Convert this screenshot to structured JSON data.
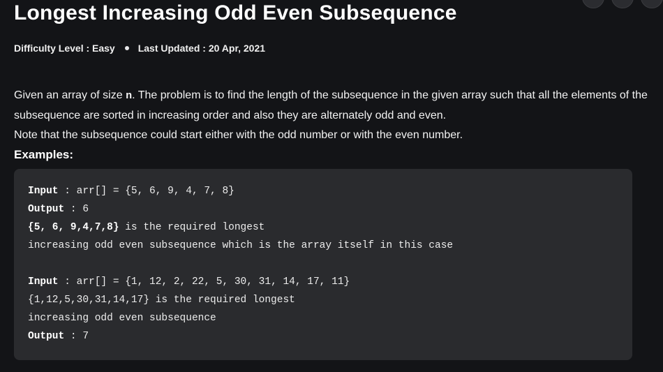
{
  "article": {
    "title": "Longest Increasing Odd Even Subsequence",
    "meta": {
      "difficulty": "Difficulty Level : Easy",
      "updated": "Last Updated : 20 Apr, 2021"
    },
    "intro": {
      "p1_before": "Given an array of size ",
      "p1_code": "n",
      "p1_after": ". The problem is to find the length of the subsequence in the given array such that all the elements of the subsequence are sorted in increasing order and also they are alternately odd and even.",
      "p2": "Note that the subsequence could start either with the odd number or with the even number.",
      "examples_heading": "Examples:"
    },
    "code_block": {
      "line1_label": "Input",
      "line1_rest": " : arr[] = {5, 6, 9, 4, 7, 8}",
      "line2_label": "Output",
      "line2_rest": " : 6",
      "line3_bold": "{5, 6, 9,4,7,8}",
      "line3_rest": " is the required longest",
      "line4": "increasing odd even subsequence which is the array itself in this case",
      "line6_label": "Input",
      "line6_rest": " : arr[] = {1, 12, 2, 22, 5, 30, 31, 14, 17, 11}",
      "line7": "{1,12,5,30,31,14,17} is the required longest",
      "line8": "increasing odd even subsequence",
      "line9_label": "Output",
      "line9_rest": " : 7"
    }
  }
}
